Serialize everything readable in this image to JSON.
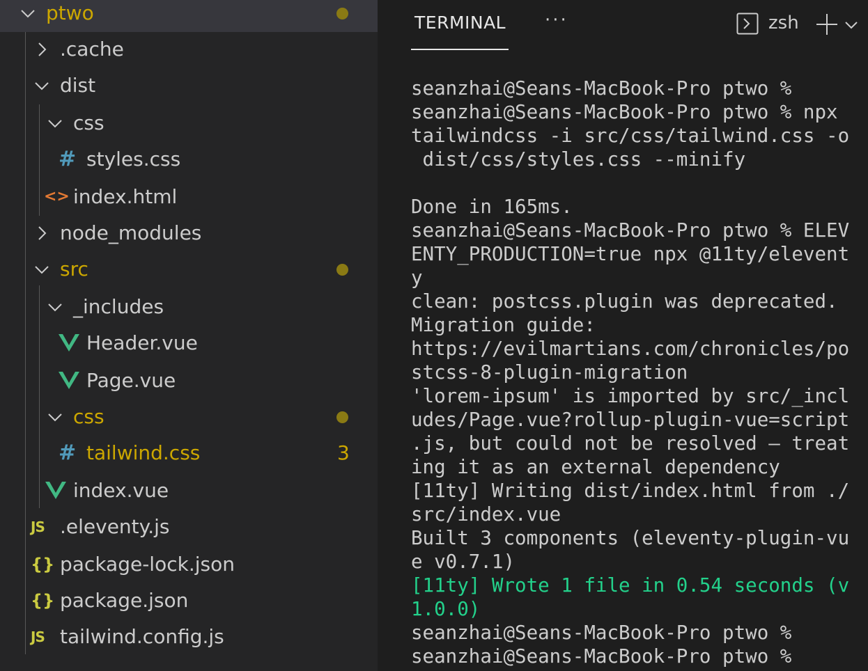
{
  "explorer": {
    "root": {
      "label": "ptwo",
      "modified": true
    },
    "items": [
      {
        "label": ".cache",
        "type": "folder",
        "expanded": false
      },
      {
        "label": "dist",
        "type": "folder",
        "expanded": true
      },
      {
        "label": "css",
        "type": "folder",
        "expanded": true
      },
      {
        "label": "styles.css",
        "type": "css-file"
      },
      {
        "label": "index.html",
        "type": "html-file"
      },
      {
        "label": "node_modules",
        "type": "folder",
        "expanded": false
      },
      {
        "label": "src",
        "type": "folder",
        "expanded": true,
        "modified": true
      },
      {
        "label": "_includes",
        "type": "folder",
        "expanded": true
      },
      {
        "label": "Header.vue",
        "type": "vue-file"
      },
      {
        "label": "Page.vue",
        "type": "vue-file"
      },
      {
        "label": "css",
        "type": "folder",
        "expanded": true,
        "modified": true
      },
      {
        "label": "tailwind.css",
        "type": "css-file",
        "modified": true,
        "problems": "3"
      },
      {
        "label": "index.vue",
        "type": "vue-file"
      },
      {
        "label": ".eleventy.js",
        "type": "js-file"
      },
      {
        "label": "package-lock.json",
        "type": "json-file"
      },
      {
        "label": "package.json",
        "type": "json-file"
      },
      {
        "label": "tailwind.config.js",
        "type": "js-file"
      }
    ],
    "icons": {
      "css": "#",
      "html": "<>",
      "js": "JS",
      "json": "{}"
    }
  },
  "panel": {
    "tab_label": "TERMINAL",
    "more_label": "···",
    "shell_name": "zsh"
  },
  "terminal": {
    "lines": [
      "seanzhai@Seans-MacBook-Pro ptwo %",
      "seanzhai@Seans-MacBook-Pro ptwo % npx",
      "tailwindcss -i src/css/tailwind.css -o",
      " dist/css/styles.css --minify",
      "",
      "Done in 165ms.",
      "seanzhai@Seans-MacBook-Pro ptwo % ELEV",
      "ENTY_PRODUCTION=true npx @11ty/elevent",
      "y",
      "clean: postcss.plugin was deprecated.",
      "Migration guide:",
      "https://evilmartians.com/chronicles/po",
      "stcss-8-plugin-migration",
      "'lorem-ipsum' is imported by src/_incl",
      "udes/Page.vue?rollup-plugin-vue=script",
      ".js, but could not be resolved – treat",
      "ing it as an external dependency",
      "[11ty] Writing dist/index.html from ./",
      "src/index.vue",
      "Built 3 components (eleventy-plugin-vu",
      "e v0.7.1)",
      "[11ty] Wrote 1 file in 0.54 seconds (v",
      "1.0.0)",
      "seanzhai@Seans-MacBook-Pro ptwo %",
      "seanzhai@Seans-MacBook-Pro ptwo %"
    ],
    "success_line_indexes": [
      21,
      22
    ]
  },
  "colors": {
    "sidebar_bg": "#252526",
    "terminal_bg": "#1e1e1e",
    "modified": "#cca700",
    "success": "#23d18b",
    "vue_green": "#41b883",
    "css_blue": "#519aba",
    "html_orange": "#e37933",
    "js_yellow": "#cbcb41"
  }
}
